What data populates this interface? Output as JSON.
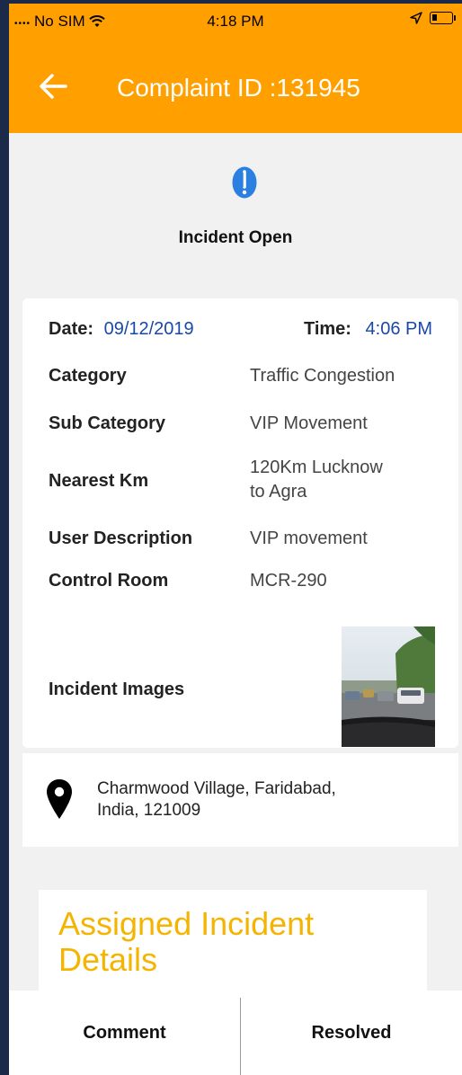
{
  "status_bar": {
    "carrier": "No SIM",
    "time": "4:18 PM"
  },
  "header": {
    "title": "Complaint ID :131945"
  },
  "incident": {
    "status": "Incident Open"
  },
  "details": {
    "date_label": "Date:",
    "date_value": "09/12/2019",
    "time_label": "Time:",
    "time_value": "4:06 PM",
    "rows": [
      {
        "label": "Category",
        "value": "Traffic Congestion"
      },
      {
        "label": "Sub Category",
        "value": "VIP Movement"
      },
      {
        "label": "Nearest Km",
        "value_line1": "120Km Lucknow",
        "value_line2": "to Agra"
      },
      {
        "label": "User Description",
        "value": "VIP movement"
      },
      {
        "label": "Control Room",
        "value": "MCR-290"
      }
    ],
    "images_label": "Incident Images"
  },
  "address": {
    "line1": "Charmwood Village, Faridabad,",
    "line2": "India, 121009"
  },
  "assigned": {
    "title_line1": "Assigned Incident",
    "title_line2": "Details"
  },
  "actions": {
    "comment": "Comment",
    "resolved": "Resolved"
  },
  "colors": {
    "accent": "#ff9f00",
    "link_blue": "#1a48a8",
    "assigned_title": "#f5b400",
    "alert_blue": "#2b7fe0"
  }
}
